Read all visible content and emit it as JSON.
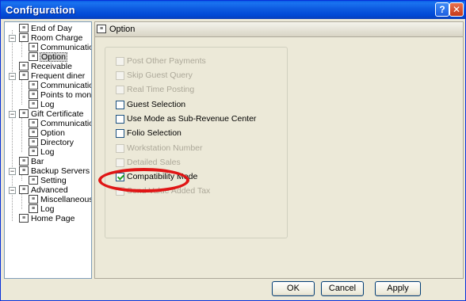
{
  "window": {
    "title": "Configuration",
    "help_label": "?",
    "close_label": "✕"
  },
  "tree": {
    "icon_glyph": "≡",
    "items": [
      {
        "label": "End of Day"
      },
      {
        "label": "Room Charge"
      },
      {
        "label": "Communication"
      },
      {
        "label": "Option"
      },
      {
        "label": "Receivable"
      },
      {
        "label": "Frequent diner"
      },
      {
        "label": "Communication"
      },
      {
        "label": "Points to money"
      },
      {
        "label": "Log"
      },
      {
        "label": "Gift Certificate"
      },
      {
        "label": "Communication"
      },
      {
        "label": "Option"
      },
      {
        "label": "Directory"
      },
      {
        "label": "Log"
      },
      {
        "label": "Bar"
      },
      {
        "label": "Backup Servers"
      },
      {
        "label": "Setting"
      },
      {
        "label": "Advanced"
      },
      {
        "label": "Miscellaneous"
      },
      {
        "label": "Log"
      },
      {
        "label": "Home Page"
      }
    ],
    "expander_glyph": "−",
    "selected_item": "Option"
  },
  "panel": {
    "title": "Option",
    "options": [
      {
        "label": "Post Other Payments",
        "checked": false,
        "enabled": false
      },
      {
        "label": "Skip Guest Query",
        "checked": false,
        "enabled": false
      },
      {
        "label": "Real Time Posting",
        "checked": false,
        "enabled": false
      },
      {
        "label": "Guest Selection",
        "checked": false,
        "enabled": true
      },
      {
        "label": "Use Mode as Sub-Revenue Center",
        "checked": false,
        "enabled": true
      },
      {
        "label": "Folio Selection",
        "checked": false,
        "enabled": true
      },
      {
        "label": "Workstation Number",
        "checked": false,
        "enabled": false
      },
      {
        "label": "Detailed Sales",
        "checked": false,
        "enabled": false
      },
      {
        "label": "Compatibility Mode",
        "checked": true,
        "enabled": true
      },
      {
        "label": "Send Value Added Tax",
        "checked": false,
        "enabled": false
      }
    ],
    "highlight_color": "#e01515"
  },
  "buttons": {
    "ok": "OK",
    "cancel": "Cancel",
    "apply": "Apply"
  }
}
